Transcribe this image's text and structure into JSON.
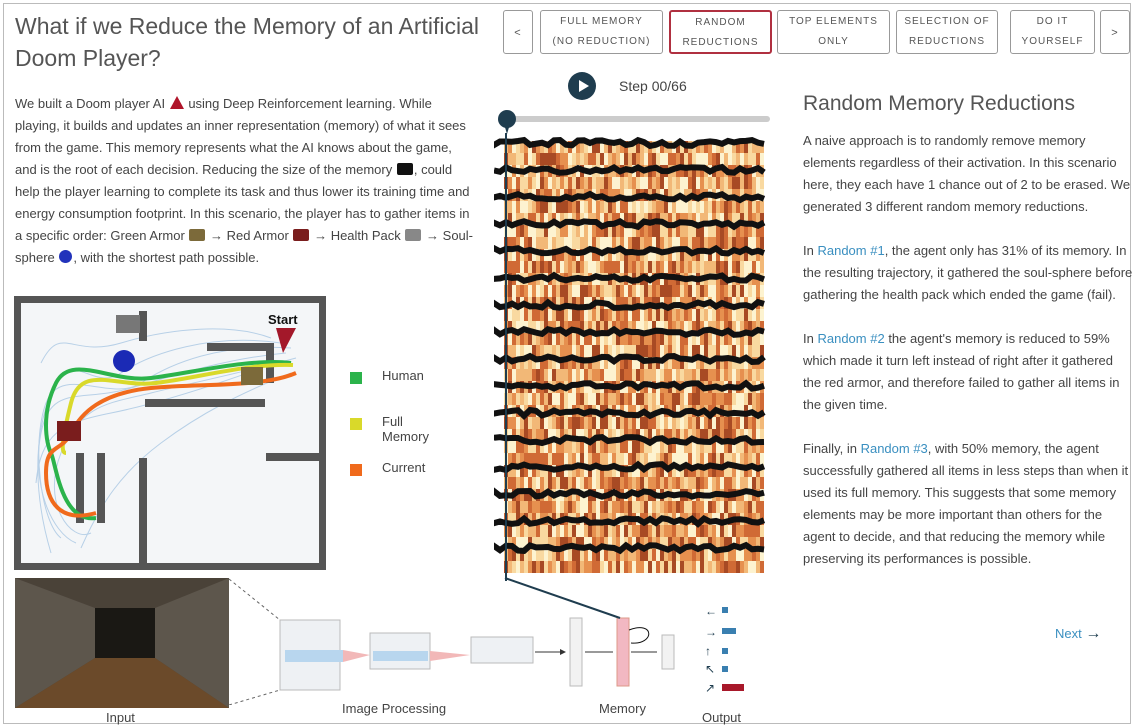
{
  "title": "What if we Reduce the Memory of an Artificial Doom Player?",
  "intro": {
    "p1": "We built a Doom player AI",
    "p2": "using Deep Reinforcement learning. While playing, it builds and updates an inner representation (memory) of what it sees from the game. This memory represents what the AI knows about the game, and is the root of each decision. Reducing the size of the memory",
    "p3": ", could help the player learning to complete its task and thus lower its training time and energy consumption footprint. In this scenario, the player has to gather items in a specific order: Green Armor",
    "arrow": "→",
    "red_armor": "Red Armor",
    "health": "Health Pack",
    "soul": "Soul-sphere",
    "end": ", with the shortest path possible."
  },
  "nav": {
    "prev": "<",
    "next": ">",
    "buttons": [
      {
        "l1": "FULL MEMORY",
        "l2": "(NO REDUCTION)"
      },
      {
        "l1": "RANDOM",
        "l2": "REDUCTIONS"
      },
      {
        "l1": "TOP ELEMENTS",
        "l2": "ONLY"
      },
      {
        "l1": "SELECTION OF",
        "l2": "REDUCTIONS"
      },
      {
        "l1": "DO IT",
        "l2": "YOURSELF"
      }
    ],
    "active_index": 1
  },
  "map": {
    "start_label": "Start"
  },
  "legend": [
    {
      "label": "Human",
      "color": "#2bb34b"
    },
    {
      "label": "Full Memory",
      "color": "#d9d92a"
    },
    {
      "label": "Current",
      "color": "#f06a1c"
    }
  ],
  "player": {
    "step": "Step 00/66",
    "progress": 0.0
  },
  "right": {
    "heading": "Random Memory Reductions",
    "p1": "A naive approach is to randomly remove memory elements regardless of their activation. In this scenario here, they each have 1 chance out of 2 to be erased. We generated 3 different random memory reductions.",
    "p2_pre": "In",
    "p2_link": "Random #1",
    "p2_post": ", the agent only has 31% of its memory. In the resulting trajectory, it gathered the soul-sphere before gathering the health pack which ended the game (fail).",
    "p3_pre": "In",
    "p3_link": "Random #2",
    "p3_post": "the agent's memory is reduced to 59% which made it turn left instead of right after it gathered the red armor, and therefore failed to gather all items in the given time.",
    "p4_pre": "Finally, in",
    "p4_link": "Random #3",
    "p4_post": ", with 50% memory, the agent successfully gathered all items in less steps than when it used its full memory. This suggests that some memory elements may be more important than others for the agent to decide, and that reducing the memory while preserving its performances is possible.",
    "next": "Next"
  },
  "captions": {
    "input": "Input",
    "processing": "Image Processing",
    "memory": "Memory",
    "output": "Output"
  },
  "colors": {
    "accent": "#1f3d4f",
    "link": "#3a8fc0",
    "active": "#b03040"
  }
}
